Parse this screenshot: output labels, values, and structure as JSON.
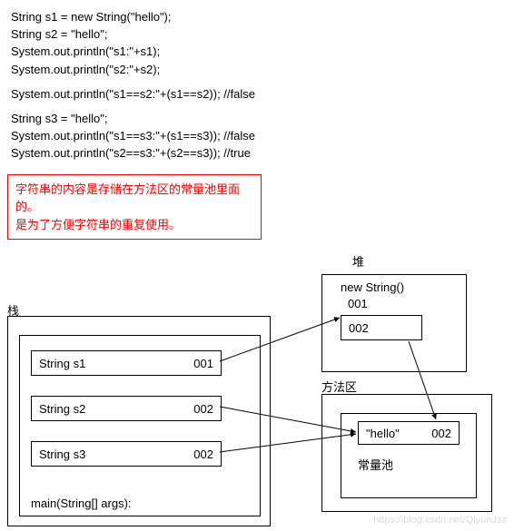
{
  "code": {
    "l1": "String s1 = new String(\"hello\");",
    "l2": "String s2 = \"hello\";",
    "l3": "System.out.println(\"s1:\"+s1);",
    "l4": "System.out.println(\"s2:\"+s2);",
    "l5": "System.out.println(\"s1==s2:\"+(s1==s2)); //false",
    "l6": "String s3 = \"hello\";",
    "l7": "System.out.println(\"s1==s3:\"+(s1==s3)); //false",
    "l8": "System.out.println(\"s2==s3:\"+(s2==s3)); //true"
  },
  "note": {
    "line1": "字符串的内容是存储在方法区的常量池里面的。",
    "line2": "是为了方便字符串的重复使用。"
  },
  "labels": {
    "heap": "堆",
    "stack": "栈",
    "method_area": "方法区",
    "constant_pool": "常量池"
  },
  "heap": {
    "new_string": "new String()",
    "addr": "001",
    "ref": "002"
  },
  "stack": {
    "rows": [
      {
        "name": "String s1",
        "val": "001"
      },
      {
        "name": "String s2",
        "val": "002"
      },
      {
        "name": "String s3",
        "val": "002"
      }
    ],
    "main": "main(String[] args):"
  },
  "pool": {
    "value": "\"hello\"",
    "addr": "002"
  },
  "watermark": "https://blog.csdn.net/QiyunJzz"
}
